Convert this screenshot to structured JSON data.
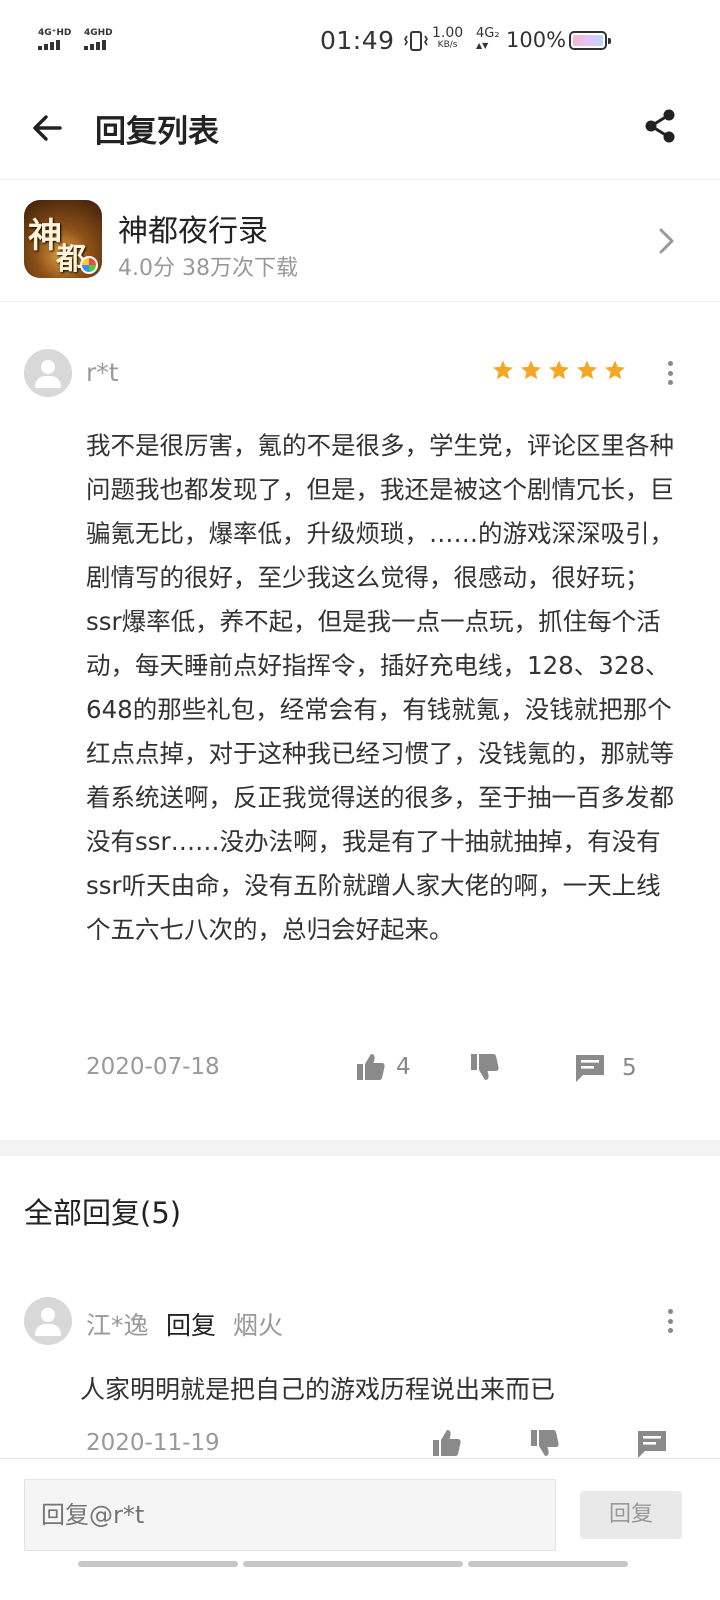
{
  "status_bar": {
    "signal1": "4G⁺HD",
    "signal2": "4GHD",
    "time": "01:49",
    "net_speed": "1.00",
    "net_speed_unit": "KB/s",
    "net_type": "4G₂",
    "battery_pct": "100%",
    "battery_level": 1.0
  },
  "header": {
    "title": "回复列表",
    "back_icon": "arrow-left-icon",
    "share_icon": "share-icon"
  },
  "app": {
    "name": "神都夜行录",
    "meta": "4.0分  38万次下载"
  },
  "review": {
    "user": "r*t",
    "rating": 5,
    "body": "我不是很厉害，氪的不是很多，学生党，评论区里各种问题我也都发现了，但是，我还是被这个剧情冗长，巨骗氪无比，爆率低，升级烦琐，……的游戏深深吸引，剧情写的很好，至少我这么觉得，很感动，很好玩；ssr爆率低，养不起，但是我一点一点玩，抓住每个活动，每天睡前点好指挥令，插好充电线，128、328、648的那些礼包，经常会有，有钱就氪，没钱就把那个红点点掉，对于这种我已经习惯了，没钱氪的，那就等着系统送啊，反正我觉得送的很多，至于抽一百多发都没有ssr……没办法啊，我是有了十抽就抽掉，有没有ssr听天由命，没有五阶就蹭人家大佬的啊，一天上线个五六七八次的，总归会好起来。",
    "date": "2020-07-18",
    "likes": "4",
    "comments": "5",
    "star_color": "#f5a623"
  },
  "replies_section": {
    "title": "全部回复(5)"
  },
  "replies": [
    {
      "user": "江*逸",
      "verb": "回复",
      "target": "烟火",
      "body": "人家明明就是把自己的游戏历程说出来而已",
      "date": "2020-11-19"
    }
  ],
  "bottom_bar": {
    "input_placeholder": "回复@r*t",
    "send_label": "回复"
  }
}
